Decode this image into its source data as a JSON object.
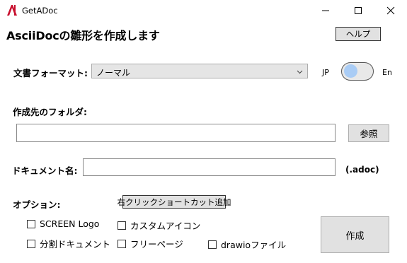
{
  "window": {
    "title": "GetADoc",
    "logo_text": "A",
    "controls": {
      "minimize": "minimize-icon",
      "maximize": "maximize-icon",
      "close": "close-icon"
    }
  },
  "header": {
    "title": "AsciiDocの雛形を作成します",
    "help_label": "ヘルプ"
  },
  "format": {
    "label": "文書フォーマット:",
    "selected": "ノーマル",
    "lang_left": "JP",
    "lang_right": "En"
  },
  "folder": {
    "label": "作成先のフォルダ:",
    "value": "",
    "browse_label": "参照"
  },
  "docname": {
    "label": "ドキュメント名:",
    "value": "",
    "extension": "(.adoc)"
  },
  "options": {
    "label": "オプション:",
    "shortcut_label": "右クリックショートカット追加",
    "checkboxes": [
      {
        "label": "SCREEN Logo",
        "checked": false
      },
      {
        "label": "カスタムアイコン",
        "checked": false
      },
      {
        "label": "分割ドキュメント",
        "checked": false
      },
      {
        "label": "フリーページ",
        "checked": false
      },
      {
        "label": "drawioファイル",
        "checked": false
      }
    ]
  },
  "create_label": "作成",
  "colors": {
    "toggle_knob": "#a9ccf5",
    "button_bg": "#e1e1e1",
    "logo_red": "#c8102e"
  }
}
